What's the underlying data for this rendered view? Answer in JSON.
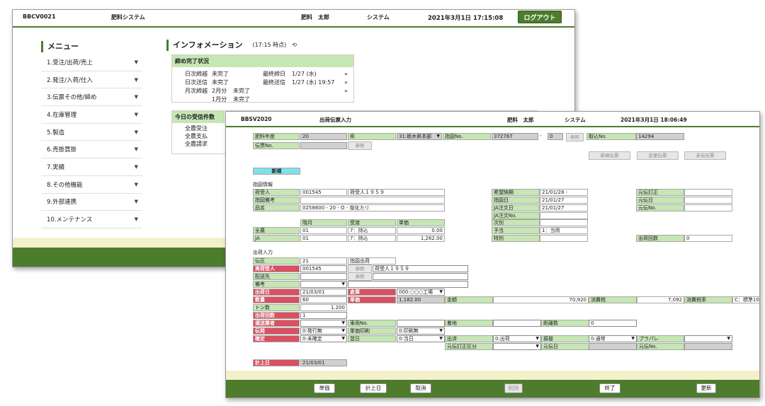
{
  "win1": {
    "screen_id": "BBCV0021",
    "system_name": "肥料システム",
    "user": "肥料　太郎",
    "system_label": "システム",
    "datetime": "2021年3月1日 17:15:08",
    "logout": "ログアウト",
    "menu_title": "メニュー",
    "menu": [
      "1.受注/出荷/売上",
      "2.発注/入荷/仕入",
      "3.伝票その他/締め",
      "4.在庫管理",
      "5.製造",
      "6.売掛買掛",
      "7.実績",
      "8.その他機能",
      "9.外部連携",
      "10.メンテナンス"
    ],
    "info_title": "インフォメーション",
    "info_time": "(17:15 時点)",
    "close_panel": {
      "title": "締め完了状況",
      "rows": [
        {
          "a": "日次締越",
          "b": "未完了",
          "c": "最終締日",
          "d": "1/27 (水)",
          "e": "»"
        },
        {
          "a": "日次送信",
          "b": "未完了",
          "c": "最終送信",
          "d": "1/27 (水) 19:57",
          "e": "»"
        },
        {
          "a": "月次締越",
          "b": "2月分",
          "b2": "未完了",
          "e": "»"
        },
        {
          "a": "",
          "b": "1月分",
          "b2": "未完了",
          "e": ""
        }
      ]
    },
    "today_panel": {
      "title": "今日の受信件数",
      "rows": [
        "全農受注",
        "全農支払",
        "全農請求"
      ]
    }
  },
  "win2": {
    "screen_id": "BBSV2020",
    "title": "出荷伝票入力",
    "user": "肥料　太郎",
    "system_label": "システム",
    "datetime": "2021年3月1日 18:06:49",
    "top": {
      "year_label": "肥料年度",
      "year": "20",
      "pref_label": "県",
      "pref": "31:栃木県本部",
      "order_label": "指図No.",
      "order": "372767",
      "dash": "-",
      "order_sub": "0",
      "ref": "参照",
      "torihiki_label": "取込No.",
      "torihiki": "14294",
      "slip_label": "伝票No.",
      "ref2": "参照",
      "btn_new": "新規伝票",
      "btn_change": "変更伝票",
      "btn_red": "赤伝伝票"
    },
    "mode": "新規",
    "shizu": {
      "section": "指図情報",
      "consignee_label": "荷受人",
      "consignee_code": "001545",
      "consignee_name": "荷受人１９５９",
      "remark_label": "指図備考",
      "item_label": "品名",
      "item": "0258600 - 20 - O - 塩化カリ",
      "due_label": "希望納期",
      "due": "21/01/28 -",
      "date_label": "指図日",
      "date": "21/01/27",
      "ja_date_label": "JA注文日",
      "ja_date": "21/01/27",
      "ja_no_label": "JA注文No.",
      "orig_fix_label": "元伝訂正",
      "orig_date_label": "元伝日",
      "orig_no_label": "元伝No.",
      "h_rank": "階月",
      "h_recv": "受渡",
      "h_price": "単価",
      "zen_label": "全農",
      "zen_rank": "01",
      "zen_recv": "7：持込",
      "zen_price": "0.00",
      "ja_label": "JA",
      "ja_rank": "01",
      "ja_recv": "7：持込",
      "ja_price": "1,262.00",
      "next_label": "次別",
      "plan_label": "予当",
      "plan": "1：当用",
      "special_label": "特別",
      "ship_count_label": "出荷回数",
      "ship_count": "0"
    },
    "ship": {
      "section": "出荷入力",
      "den_label": "伝区",
      "den": "21",
      "shizu_ship_label": "指図出荷",
      "consignee_label": "実荷受人",
      "consignee_code": "001545",
      "consignee_ref": "参照",
      "consignee_name": "荷受人１９５９",
      "dest_label": "配送先",
      "dest_ref": "参照",
      "note_label": "備考",
      "ship_date_label": "出荷日",
      "ship_date": "21/03/01",
      "warehouse_label": "倉庫",
      "warehouse": "000:○○○工場",
      "qty_label": "数量",
      "qty": "60",
      "price_label": "単価",
      "price": "1,182.00",
      "amount_label": "金額",
      "amount": "70,920",
      "tax_label": "消費税",
      "tax": "7,092",
      "tax_rate_label": "消費税率",
      "tax_rate": "C：標準10%",
      "ton_label": "トン数",
      "ton": "1.200",
      "count_label": "出荷回数",
      "count": "1",
      "carrier_label": "運送業者",
      "truck_label": "車両No.",
      "arrive_label": "着地",
      "distance_label": "距離数",
      "distance": "0",
      "slip_label": "伝発",
      "slip": "0:発行無",
      "price_print_label": "単価印刷",
      "price_print": "0:印刷無",
      "fix_label": "確定",
      "fix": "0:未確定",
      "sameday_label": "翌日",
      "sameday": "0:当日",
      "out_label": "出済",
      "out": "0:出荷",
      "transfer_label": "振替",
      "transfer": "0:通常",
      "pallet_label": "プラパレ",
      "orig_fix_cls_label": "元伝訂正区分",
      "orig_date_label": "元伝日",
      "orig_no_label": "元伝No.",
      "keijo_label": "計上日",
      "keijo": "21/03/01"
    },
    "footer": [
      "単価",
      "計上日",
      "取消",
      "削除",
      "終了",
      "更新"
    ]
  }
}
